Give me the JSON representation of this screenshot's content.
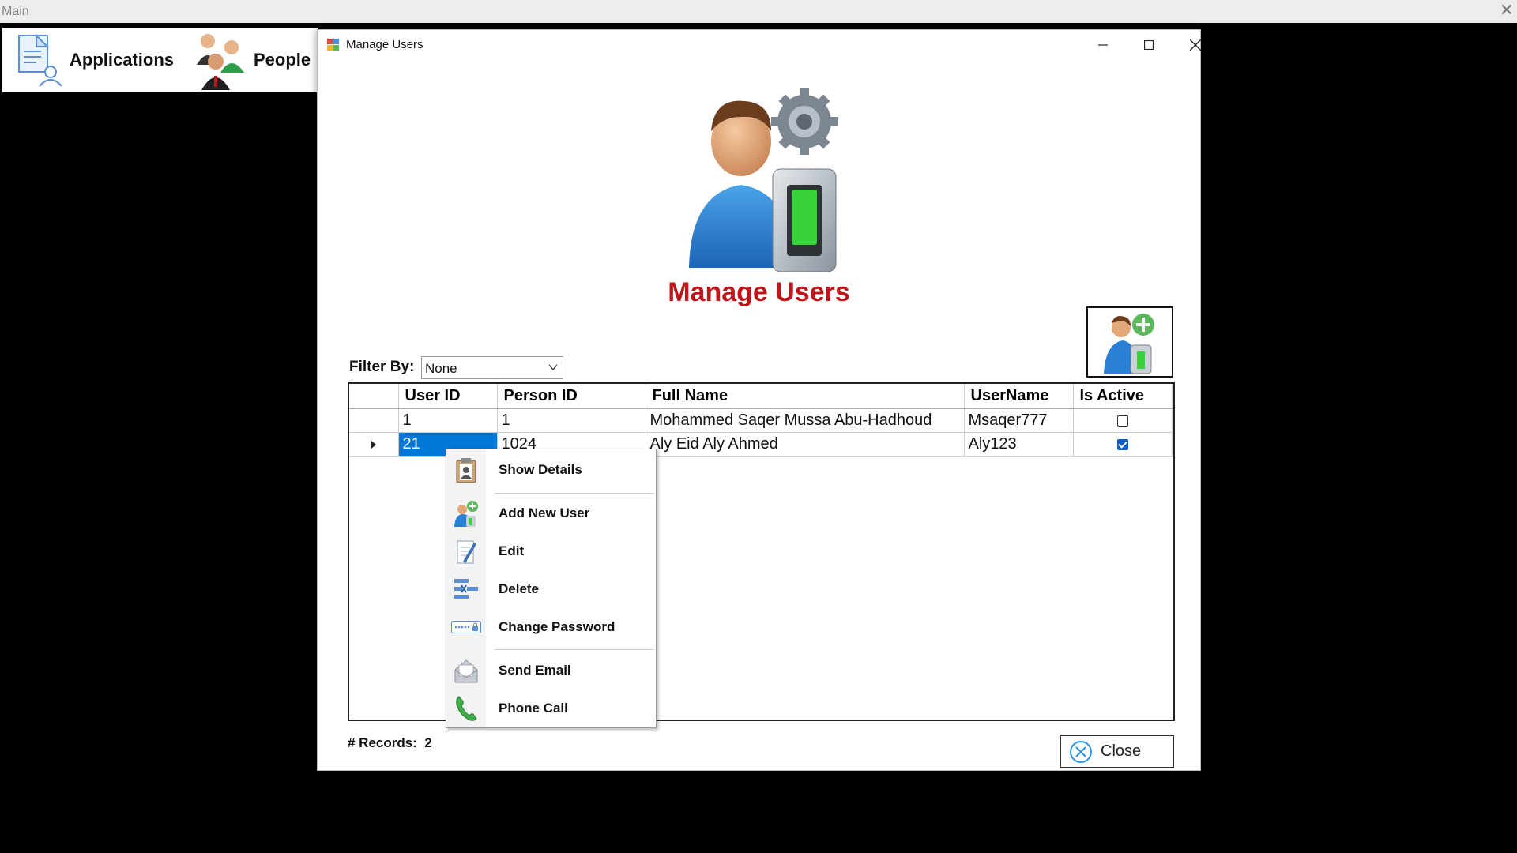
{
  "main_window": {
    "title": "Main",
    "close_glyph": "✕"
  },
  "toolbar": {
    "items": [
      {
        "label": "Applications",
        "icon": "applications-icon"
      },
      {
        "label": "People",
        "icon": "people-icon"
      }
    ]
  },
  "dialog": {
    "title": "Manage Users",
    "heading": "Manage Users",
    "filter": {
      "label": "Filter By:",
      "selected": "None"
    },
    "grid": {
      "columns": [
        "User ID",
        "Person ID",
        "Full Name",
        "UserName",
        "Is Active"
      ],
      "rows": [
        {
          "user_id": "1",
          "person_id": "1",
          "full_name": "Mohammed Saqer Mussa Abu-Hadhoud",
          "username": "Msaqer777",
          "is_active": false
        },
        {
          "user_id": "21",
          "person_id": "1024",
          "full_name": "Aly Eid Aly Ahmed",
          "username": "Aly123",
          "is_active": true
        }
      ],
      "selected_row": 1
    },
    "records": {
      "label": "# Records:",
      "count": "2"
    },
    "close_label": "Close"
  },
  "context_menu": {
    "items": [
      {
        "label": "Show Details",
        "icon": "clipboard-person-icon"
      },
      {
        "label": "Add New User",
        "icon": "add-user-icon"
      },
      {
        "label": "Edit",
        "icon": "edit-document-icon"
      },
      {
        "label": "Delete",
        "icon": "delete-list-icon"
      },
      {
        "label": "Change Password",
        "icon": "password-field-icon"
      },
      {
        "label": "Send Email",
        "icon": "envelope-icon"
      },
      {
        "label": "Phone Call",
        "icon": "phone-icon"
      }
    ]
  },
  "colors": {
    "accent": "#0078d7",
    "title_red": "#c0161b",
    "checkbox_blue": "#0b5fc4"
  }
}
